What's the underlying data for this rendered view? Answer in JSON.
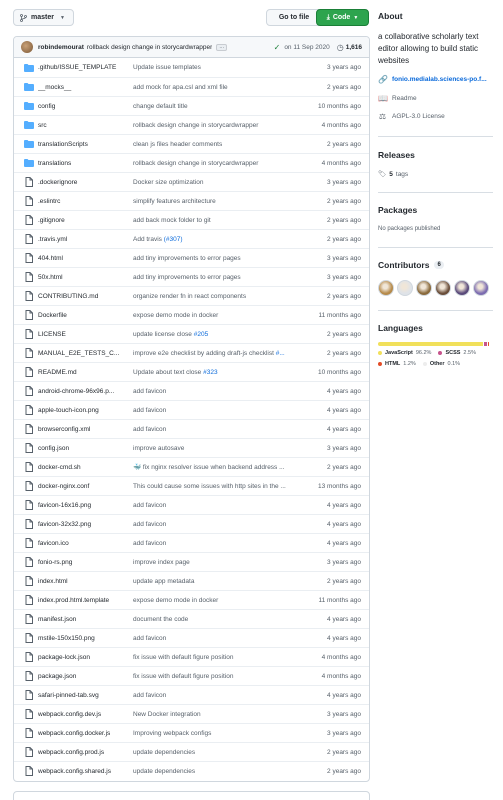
{
  "toolbar": {
    "branch": "master",
    "goto_file": "Go to file",
    "code": "Code"
  },
  "commit": {
    "author": "robindemourat",
    "message": "rollback design change in storycardwrapper",
    "more": "…",
    "date": "on 11 Sep 2020",
    "count": "1,616"
  },
  "files": [
    {
      "type": "dir",
      "name": ".github/ISSUE_TEMPLATE",
      "msg": "Update issue templates",
      "time": "3 years ago"
    },
    {
      "type": "dir",
      "name": "__mocks__",
      "msg": "add mock for apa.csl and xml file",
      "time": "2 years ago"
    },
    {
      "type": "dir",
      "name": "config",
      "msg": "change default title",
      "time": "10 months ago"
    },
    {
      "type": "dir",
      "name": "src",
      "msg": "rollback design change in storycardwrapper",
      "time": "4 months ago"
    },
    {
      "type": "dir",
      "name": "translationScripts",
      "msg": "clean js files header comments",
      "time": "2 years ago"
    },
    {
      "type": "dir",
      "name": "translations",
      "msg": "rollback design change in storycardwrapper",
      "time": "4 months ago"
    },
    {
      "type": "file",
      "name": ".dockerignore",
      "msg": "Docker size optimization",
      "time": "3 years ago"
    },
    {
      "type": "file",
      "name": ".eslintrc",
      "msg": "simplify features architecture",
      "time": "2 years ago"
    },
    {
      "type": "file",
      "name": ".gitignore",
      "msg": "add back mock folder to git",
      "time": "2 years ago"
    },
    {
      "type": "file",
      "name": ".travis.yml",
      "msg": "Add travis ",
      "link": "(#307)",
      "time": "2 years ago"
    },
    {
      "type": "file",
      "name": "404.html",
      "msg": "add tiny improvements to error pages",
      "time": "3 years ago"
    },
    {
      "type": "file",
      "name": "50x.html",
      "msg": "add tiny improvements to error pages",
      "time": "3 years ago"
    },
    {
      "type": "file",
      "name": "CONTRIBUTING.md",
      "msg": "organize render fn in react components",
      "time": "2 years ago"
    },
    {
      "type": "file",
      "name": "Dockerfile",
      "msg": "expose demo mode in docker",
      "time": "11 months ago"
    },
    {
      "type": "file",
      "name": "LICENSE",
      "msg": "update license close ",
      "link": "#205",
      "time": "2 years ago"
    },
    {
      "type": "file",
      "name": "MANUAL_E2E_TESTS_C...",
      "msg": "improve e2e checklist by adding draft-js checklist ",
      "link": "#...",
      "time": "2 years ago"
    },
    {
      "type": "file",
      "name": "README.md",
      "msg": "Update about text close ",
      "link": "#323",
      "time": "10 months ago"
    },
    {
      "type": "file",
      "name": "android-chrome-96x96.p...",
      "msg": "add favicon",
      "time": "4 years ago"
    },
    {
      "type": "file",
      "name": "apple-touch-icon.png",
      "msg": "add favicon",
      "time": "4 years ago"
    },
    {
      "type": "file",
      "name": "browserconfig.xml",
      "msg": "add favicon",
      "time": "4 years ago"
    },
    {
      "type": "file",
      "name": "config.json",
      "msg": "improve autosave",
      "time": "3 years ago"
    },
    {
      "type": "file",
      "name": "docker-cmd.sh",
      "msg": "🐳 fix nginx resolver issue when backend address ...",
      "time": "2 years ago"
    },
    {
      "type": "file",
      "name": "docker-nginx.conf",
      "msg": "This could cause some issues with http sites in the ...",
      "time": "13 months ago"
    },
    {
      "type": "file",
      "name": "favicon-16x16.png",
      "msg": "add favicon",
      "time": "4 years ago"
    },
    {
      "type": "file",
      "name": "favicon-32x32.png",
      "msg": "add favicon",
      "time": "4 years ago"
    },
    {
      "type": "file",
      "name": "favicon.ico",
      "msg": "add favicon",
      "time": "4 years ago"
    },
    {
      "type": "file",
      "name": "fonio-rs.png",
      "msg": "improve index page",
      "time": "3 years ago"
    },
    {
      "type": "file",
      "name": "index.html",
      "msg": "update app metadata",
      "time": "2 years ago"
    },
    {
      "type": "file",
      "name": "index.prod.html.template",
      "msg": "expose demo mode in docker",
      "time": "11 months ago"
    },
    {
      "type": "file",
      "name": "manifest.json",
      "msg": "document the code",
      "time": "4 years ago"
    },
    {
      "type": "file",
      "name": "mstile-150x150.png",
      "msg": "add favicon",
      "time": "4 years ago"
    },
    {
      "type": "file",
      "name": "package-lock.json",
      "msg": "fix issue with default figure position",
      "time": "4 months ago"
    },
    {
      "type": "file",
      "name": "package.json",
      "msg": "fix issue with default figure position",
      "time": "4 months ago"
    },
    {
      "type": "file",
      "name": "safari-pinned-tab.svg",
      "msg": "add favicon",
      "time": "4 years ago"
    },
    {
      "type": "file",
      "name": "webpack.config.dev.js",
      "msg": "New Docker integration",
      "time": "3 years ago"
    },
    {
      "type": "file",
      "name": "webpack.config.docker.js",
      "msg": "Improving webpack configs",
      "time": "3 years ago"
    },
    {
      "type": "file",
      "name": "webpack.config.prod.js",
      "msg": "update dependencies",
      "time": "2 years ago"
    },
    {
      "type": "file",
      "name": "webpack.config.shared.js",
      "msg": "update dependencies",
      "time": "2 years ago"
    }
  ],
  "about": {
    "title": "About",
    "description": "a collaborative scholarly text editor allowing to build static websites",
    "website": "fonio.medialab.sciences-po.f...",
    "readme": "Readme",
    "license": "AGPL-3.0 License"
  },
  "releases": {
    "title": "Releases",
    "tags_count": "5",
    "tags_label": "tags"
  },
  "packages": {
    "title": "Packages",
    "empty": "No packages published"
  },
  "contributors": {
    "title": "Contributors",
    "count": "6",
    "avatar_colors": [
      "#b68a4a",
      "#dfe3e8",
      "#8a6a3c",
      "#6a4e3a",
      "#5a4a7a",
      "#7c6cb0"
    ]
  },
  "languages": {
    "title": "Languages",
    "items": [
      {
        "name": "JavaScript",
        "pct": "96.2%",
        "share": 96.2,
        "color": "#f1e05a"
      },
      {
        "name": "SCSS",
        "pct": "2.5%",
        "share": 2.5,
        "color": "#c6538c"
      },
      {
        "name": "HTML",
        "pct": "1.2%",
        "share": 1.2,
        "color": "#e34c26"
      },
      {
        "name": "Other",
        "pct": "0.1%",
        "share": 0.1,
        "color": "#ededed"
      }
    ]
  }
}
